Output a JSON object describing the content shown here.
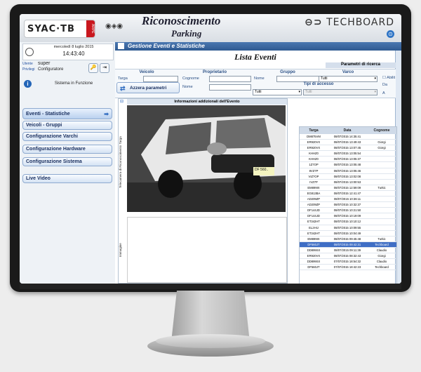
{
  "header": {
    "logo": "SYAC·TB",
    "logo_sub": "ARPE",
    "title": "Riconoscimento",
    "subtitle": "Parking",
    "brand": "TECHBOARD"
  },
  "sidebar": {
    "date": "mercoledì 8 luglio 2015",
    "time": "14:43:40",
    "user_label": "Utente",
    "user_value": "super",
    "privilege_label": "Privilegi",
    "privilege_value": "Configuratore",
    "status": "Sistema in Funzione",
    "nav": [
      {
        "label": "Eventi - Statistiche"
      },
      {
        "label": "Veicoli - Gruppi"
      },
      {
        "label": "Configurazione Varchi"
      },
      {
        "label": "Configurazione Hardware"
      },
      {
        "label": "Configurazione Sistema"
      },
      {
        "label": "Live Video"
      }
    ]
  },
  "main": {
    "section_title": "Gestione Eventi e Statistiche",
    "list_title": "Lista Eventi",
    "params_title": "Parametri di ricerca",
    "filters": {
      "veicolo_title": "Veicolo",
      "targa_label": "Targa",
      "proprietario_title": "Proprietario",
      "cognome_label": "Cognome",
      "nome_label": "Nome",
      "gruppo_title": "Gruppo",
      "gruppo_nome_label": "Nome",
      "varco_title": "Varco",
      "varco_value": "Tutti",
      "tipi_title": "Tipi di accesso",
      "tipi_value": "Tutti",
      "tipi_value2": "Tutti",
      "abilit_label": "Abilit",
      "da_label": "Da",
      "a_label": "A",
      "reset_label": "Azzera parametri"
    },
    "info_title": "Informazioni addizionali dell'Evento",
    "vlabel1": "Telecamera di Riconoscimento Targa",
    "vlabel2": "Immagine",
    "plate_text": "DF 560..",
    "table": {
      "headers": [
        "Targa",
        "Data",
        "Cognome"
      ],
      "rows": [
        [
          "DM875VM",
          "08/07/2015 14:35:41",
          ""
        ],
        [
          "ER920VX",
          "08/07/2015 13:49:43",
          "Giorgi"
        ],
        [
          "ER920VX",
          "08/07/2015 13:07:45",
          "Giorgi"
        ],
        [
          "KHHZ0",
          "08/07/2015 13:05:54",
          ""
        ],
        [
          "KHHZ0",
          "08/07/2015 13:05:37",
          ""
        ],
        [
          "1Z7OP",
          "08/07/2015 13:05:48",
          ""
        ],
        [
          "8VZ7P",
          "08/07/2015 13:05:46",
          ""
        ],
        [
          "VIZ7OP",
          "08/07/2015 13:02:08",
          ""
        ],
        [
          "IVZ7P",
          "08/07/2015 13:00:53",
          ""
        ],
        [
          "EM899IX",
          "08/07/2015 12:59:09",
          "Turkic"
        ],
        [
          "EG813BA",
          "08/07/2015 12:41:47",
          ""
        ],
        [
          "AD209ZP",
          "08/07/2015 10:36:11",
          ""
        ],
        [
          "AD209ZP",
          "08/07/2015 10:32:37",
          ""
        ],
        [
          "DF144JD",
          "08/07/2015 10:21:50",
          ""
        ],
        [
          "DF144JD",
          "08/07/2015 10:19:09",
          ""
        ],
        [
          "ET342HT",
          "08/07/2015 10:10:12",
          ""
        ],
        [
          "EL2HIJ",
          "08/07/2015 10:09:55",
          ""
        ],
        [
          "ET342HT",
          "08/07/2015 10:04:49",
          ""
        ],
        [
          "EM899IX",
          "08/07/2015 09:45:48",
          "Turkic"
        ],
        [
          "DF560JT",
          "08/07/2015 09:42:31",
          "Techboard"
        ],
        [
          "DD899SX",
          "08/07/2015 09:11:39",
          "Claudio"
        ],
        [
          "ER920VX",
          "08/07/2015 08:32:43",
          "Giorgi"
        ],
        [
          "DD899SX",
          "07/07/2015 18:54:32",
          "Claudio"
        ],
        [
          "DF560JT",
          "07/07/2015 18:42:23",
          "Techboard"
        ]
      ],
      "selected_index": 19
    }
  },
  "colors": {
    "accent": "#2f5a91",
    "selection": "#3f6ec5",
    "logo_red": "#c9171e"
  }
}
